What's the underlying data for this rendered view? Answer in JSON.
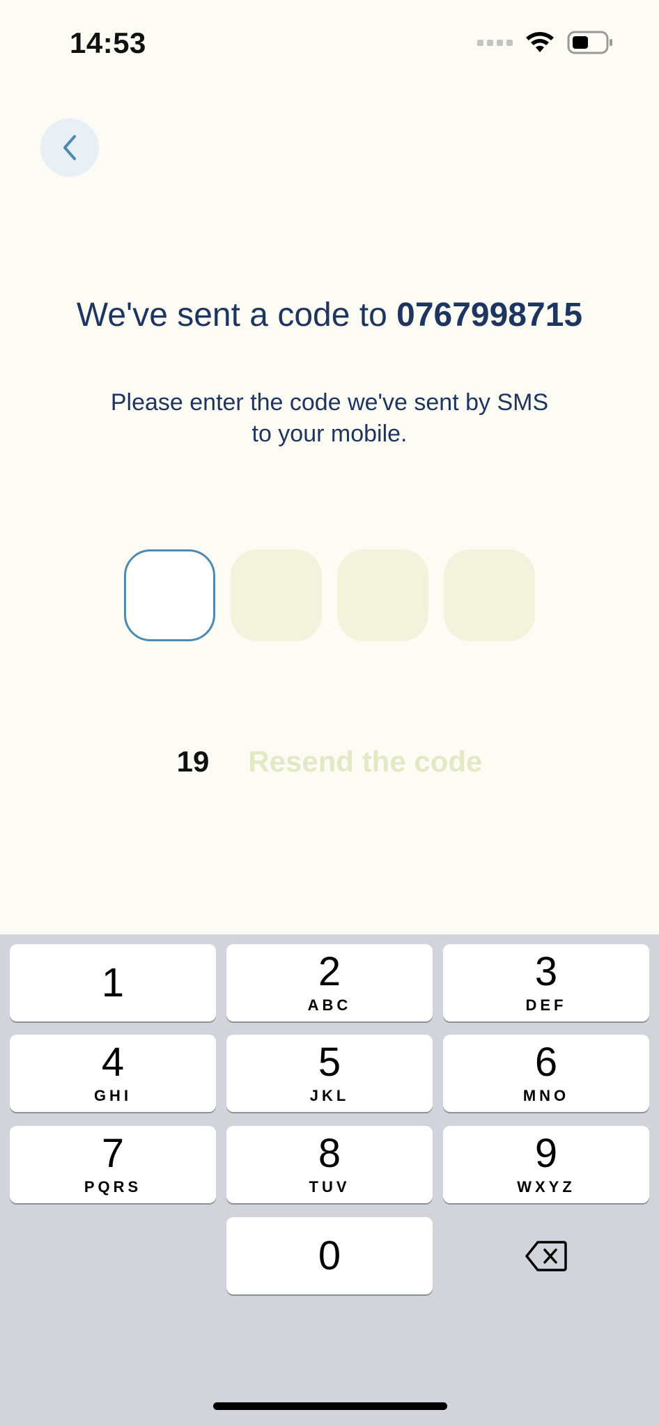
{
  "status_bar": {
    "time": "14:53",
    "signal_icon": "signal-dots-icon",
    "wifi_icon": "wifi-icon",
    "battery_icon": "battery-icon"
  },
  "back_button": {
    "icon": "chevron-left-icon"
  },
  "heading": {
    "prefix": "We've sent a code to ",
    "phone": "0767998715"
  },
  "subtext": {
    "line1": "Please enter the code we've sent by SMS",
    "line2": "to your mobile."
  },
  "code_input": {
    "length": 4,
    "active_index": 0,
    "active_border": "#4d8ab0",
    "empty_fill": "#f1f3dd"
  },
  "timer": {
    "countdown": "19",
    "resend_label": "Resend the code",
    "resend_color": "#e3e8c5"
  },
  "keypad": {
    "keys": [
      {
        "digit": "1",
        "letters": ""
      },
      {
        "digit": "2",
        "letters": "ABC"
      },
      {
        "digit": "3",
        "letters": "DEF"
      },
      {
        "digit": "4",
        "letters": "GHI"
      },
      {
        "digit": "5",
        "letters": "JKL"
      },
      {
        "digit": "6",
        "letters": "MNO"
      },
      {
        "digit": "7",
        "letters": "PQRS"
      },
      {
        "digit": "8",
        "letters": "TUV"
      },
      {
        "digit": "9",
        "letters": "WXYZ"
      },
      {
        "digit": "0",
        "letters": ""
      }
    ],
    "delete_icon": "backspace-icon"
  },
  "colors": {
    "background": "#fdfcf4",
    "primary_text": "#1e3560",
    "keyboard_bg": "#d1d4db"
  }
}
